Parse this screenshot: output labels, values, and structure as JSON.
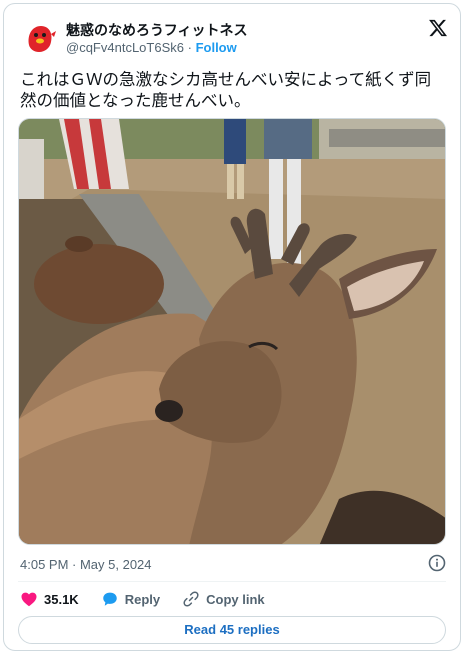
{
  "tweet": {
    "author_name": "魅惑のなめろうフィットネス",
    "handle": "@cqFv4ntcLoT6Sk6",
    "separator": "·",
    "follow_label": "Follow",
    "text": "これはＧＷの急激なシカ高せんべい安によって紙くず同然の価値となった鹿せんべい。",
    "timestamp": "4:05 PM · May 5, 2024",
    "likes_count": "35.1K",
    "reply_label": "Reply",
    "copy_link_label": "Copy link",
    "read_replies_label": "Read 45 replies"
  },
  "icons": {
    "avatar": "red-mascot-avatar",
    "brand": "x-logo-icon",
    "info": "info-icon",
    "like": "heart-icon",
    "reply": "speech-bubble-icon",
    "copy_link": "link-icon"
  },
  "colors": {
    "accent": "#1d9bf0",
    "like": "#f91880",
    "avatar_red": "#e0242a",
    "muted_text": "#536471"
  }
}
